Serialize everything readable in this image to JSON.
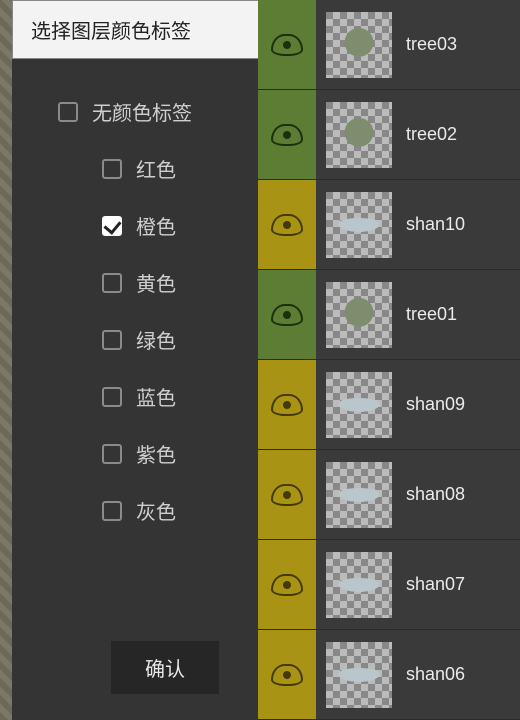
{
  "panel": {
    "title": "选择图层颜色标签",
    "no_color": "无颜色标签",
    "colors": {
      "red": {
        "label": "红色",
        "checked": false
      },
      "orange": {
        "label": "橙色",
        "checked": true
      },
      "yellow": {
        "label": "黄色",
        "checked": false
      },
      "green": {
        "label": "绿色",
        "checked": false
      },
      "blue": {
        "label": "蓝色",
        "checked": false
      },
      "purple": {
        "label": "紫色",
        "checked": false
      },
      "gray": {
        "label": "灰色",
        "checked": false
      }
    },
    "confirm": "确认"
  },
  "layers": [
    {
      "name": "tree03",
      "tag": "green",
      "kind": "tree"
    },
    {
      "name": "tree02",
      "tag": "green",
      "kind": "tree"
    },
    {
      "name": "shan10",
      "tag": "olive",
      "kind": "cloud"
    },
    {
      "name": "tree01",
      "tag": "green",
      "kind": "tree"
    },
    {
      "name": "shan09",
      "tag": "olive",
      "kind": "cloud"
    },
    {
      "name": "shan08",
      "tag": "olive",
      "kind": "cloud"
    },
    {
      "name": "shan07",
      "tag": "olive",
      "kind": "cloud"
    },
    {
      "name": "shan06",
      "tag": "olive",
      "kind": "cloud"
    }
  ]
}
